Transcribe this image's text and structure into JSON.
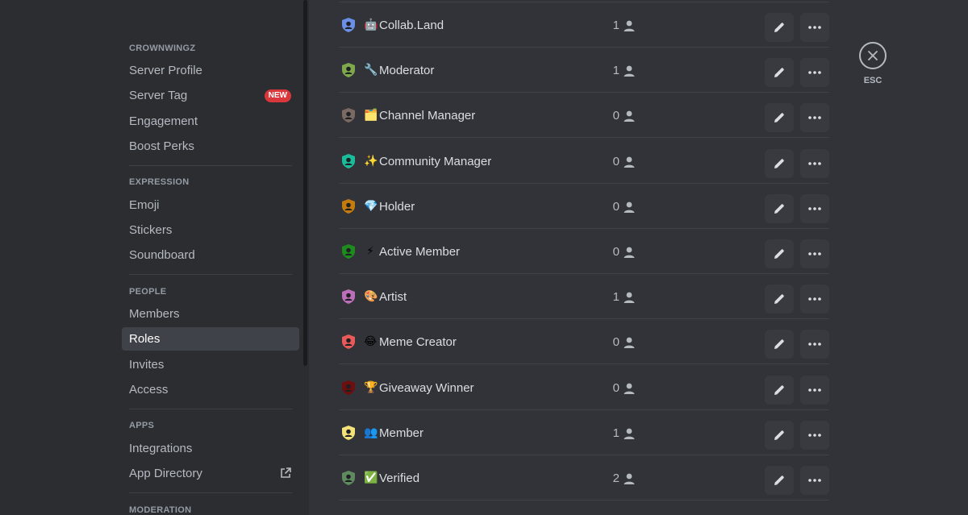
{
  "sidebar": {
    "sections": [
      {
        "title": "CROWNWINGZ",
        "items": [
          {
            "label": "Server Profile"
          },
          {
            "label": "Server Tag",
            "badge": "NEW"
          },
          {
            "label": "Engagement"
          },
          {
            "label": "Boost Perks"
          }
        ]
      },
      {
        "title": "EXPRESSION",
        "items": [
          {
            "label": "Emoji"
          },
          {
            "label": "Stickers"
          },
          {
            "label": "Soundboard"
          }
        ]
      },
      {
        "title": "PEOPLE",
        "items": [
          {
            "label": "Members"
          },
          {
            "label": "Roles",
            "selected": true
          },
          {
            "label": "Invites"
          },
          {
            "label": "Access"
          }
        ]
      },
      {
        "title": "APPS",
        "items": [
          {
            "label": "Integrations"
          },
          {
            "label": "App Directory",
            "icon": "external-link-icon"
          }
        ]
      },
      {
        "title": "MODERATION",
        "items": []
      }
    ]
  },
  "roles": [
    {
      "name": "Collab.Land",
      "emoji": "🤖",
      "count": "1",
      "color": "#6b8ee6"
    },
    {
      "name": "Moderator",
      "emoji": "🔧",
      "count": "1",
      "color": "#7fa84d"
    },
    {
      "name": "Channel Manager",
      "emoji": "🗂️",
      "count": "0",
      "color": "#7b6a63"
    },
    {
      "name": "Community Manager",
      "emoji": "✨",
      "count": "0",
      "color": "#1abc9c"
    },
    {
      "name": "Holder",
      "emoji": "💎",
      "count": "0",
      "color": "#c27c0e"
    },
    {
      "name": "Active Member",
      "emoji": "⚡",
      "count": "0",
      "color": "#1f8b1f"
    },
    {
      "name": "Artist",
      "emoji": "🎨",
      "count": "1",
      "color": "#b96fb9"
    },
    {
      "name": "Meme Creator",
      "emoji": "😂",
      "count": "0",
      "color": "#e85a5a"
    },
    {
      "name": "Giveaway Winner",
      "emoji": "🏆",
      "count": "0",
      "color": "#6b0f0f"
    },
    {
      "name": "Member",
      "emoji": "👥",
      "count": "1",
      "color": "#f3e27a"
    },
    {
      "name": "Verified",
      "emoji": "✅",
      "count": "2",
      "color": "#5f8a5f"
    }
  ],
  "close": {
    "label": "ESC"
  },
  "colors": {
    "accent": "#5865f2",
    "danger": "#da373c"
  }
}
